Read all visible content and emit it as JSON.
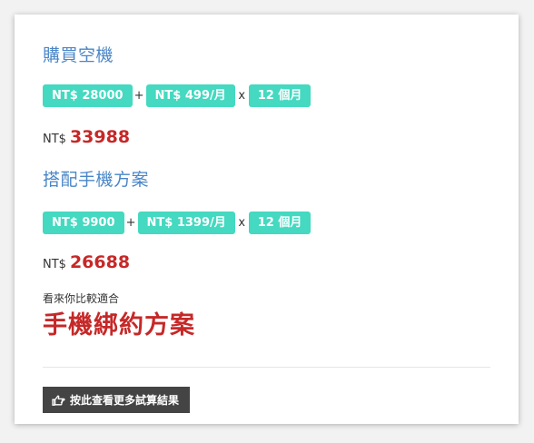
{
  "phone_purchase": {
    "title": "購買空機",
    "formula": {
      "device_price": "NT$ 28000",
      "plus": "+",
      "monthly_fee": "NT$ 499/月",
      "times": "x",
      "months": "12 個月"
    },
    "total": {
      "currency": "NT$",
      "amount": "33988"
    }
  },
  "contract_plan": {
    "title": "搭配手機方案",
    "formula": {
      "device_price": "NT$ 9900",
      "plus": "+",
      "monthly_fee": "NT$ 1399/月",
      "times": "x",
      "months": "12 個月"
    },
    "total": {
      "currency": "NT$",
      "amount": "26688"
    }
  },
  "recommendation": {
    "hint": "看來你比較適合",
    "result": "手機綁約方案"
  },
  "more_button": {
    "icon": "hand-pointing-icon",
    "label": "按此查看更多試算結果"
  },
  "colors": {
    "title_blue": "#4a86c7",
    "tag_teal": "#44d9c0",
    "price_red": "#c62828",
    "button_dark": "#444444"
  }
}
